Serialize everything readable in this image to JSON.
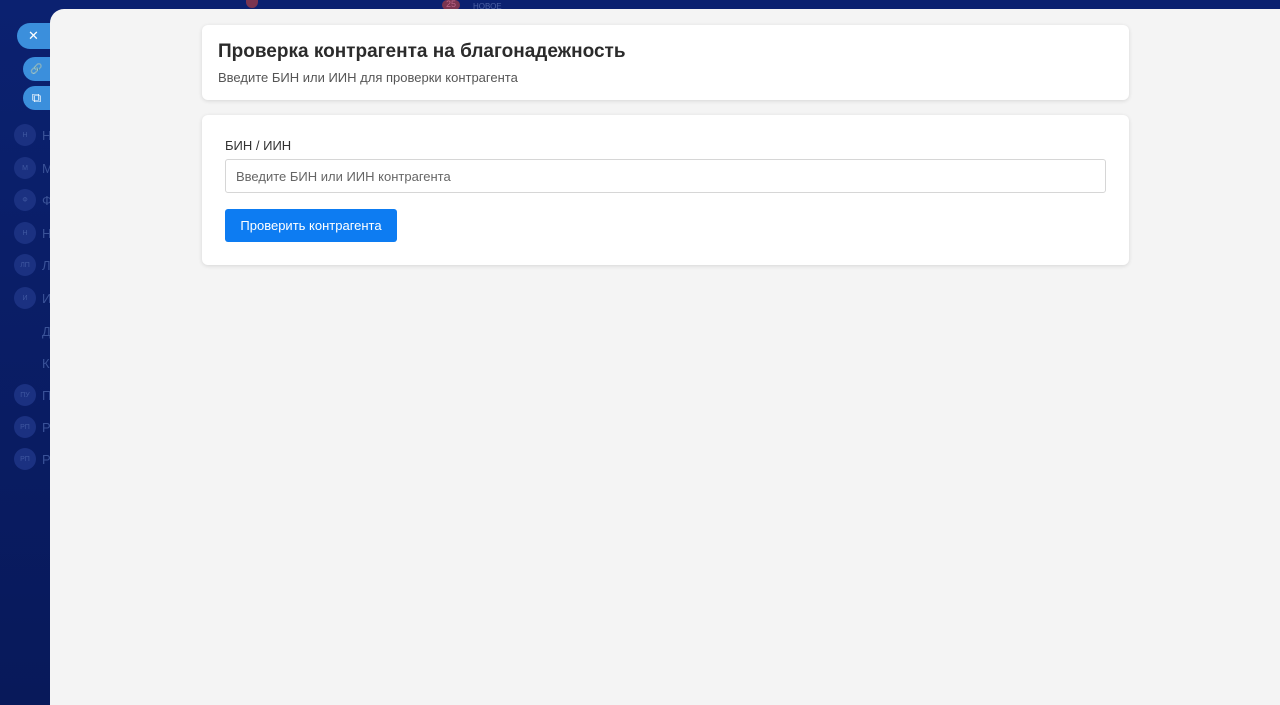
{
  "background": {
    "top_badge": "25",
    "top_label": "НОВОЕ",
    "sidebar": [
      {
        "badge": "Н",
        "label": "Н"
      },
      {
        "badge": "М",
        "label": "М"
      },
      {
        "badge": "Ф",
        "label": "Ф"
      },
      {
        "badge": "Н",
        "label": "Н"
      },
      {
        "badge": "ЛП",
        "label": "Л"
      },
      {
        "badge": "И",
        "label": "И"
      },
      {
        "badge": "",
        "label": "Д"
      },
      {
        "badge": "",
        "label": "К"
      },
      {
        "badge": "ПУ",
        "label": "П"
      },
      {
        "badge": "РП",
        "label": "Р"
      },
      {
        "badge": "РП",
        "label": "Р"
      }
    ]
  },
  "fabs": {
    "close": "✕",
    "link": "🔗",
    "external": "⧉"
  },
  "header": {
    "title": "Проверка контрагента на благонадежность",
    "subtitle": "Введите БИН или ИИН для проверки контрагента"
  },
  "form": {
    "label": "БИН / ИИН",
    "value": "",
    "placeholder": "Введите БИН или ИИН контрагента",
    "submit": "Проверить контрагента"
  },
  "colors": {
    "accent": "#0d7cf2",
    "backdrop": "#0b2170"
  }
}
